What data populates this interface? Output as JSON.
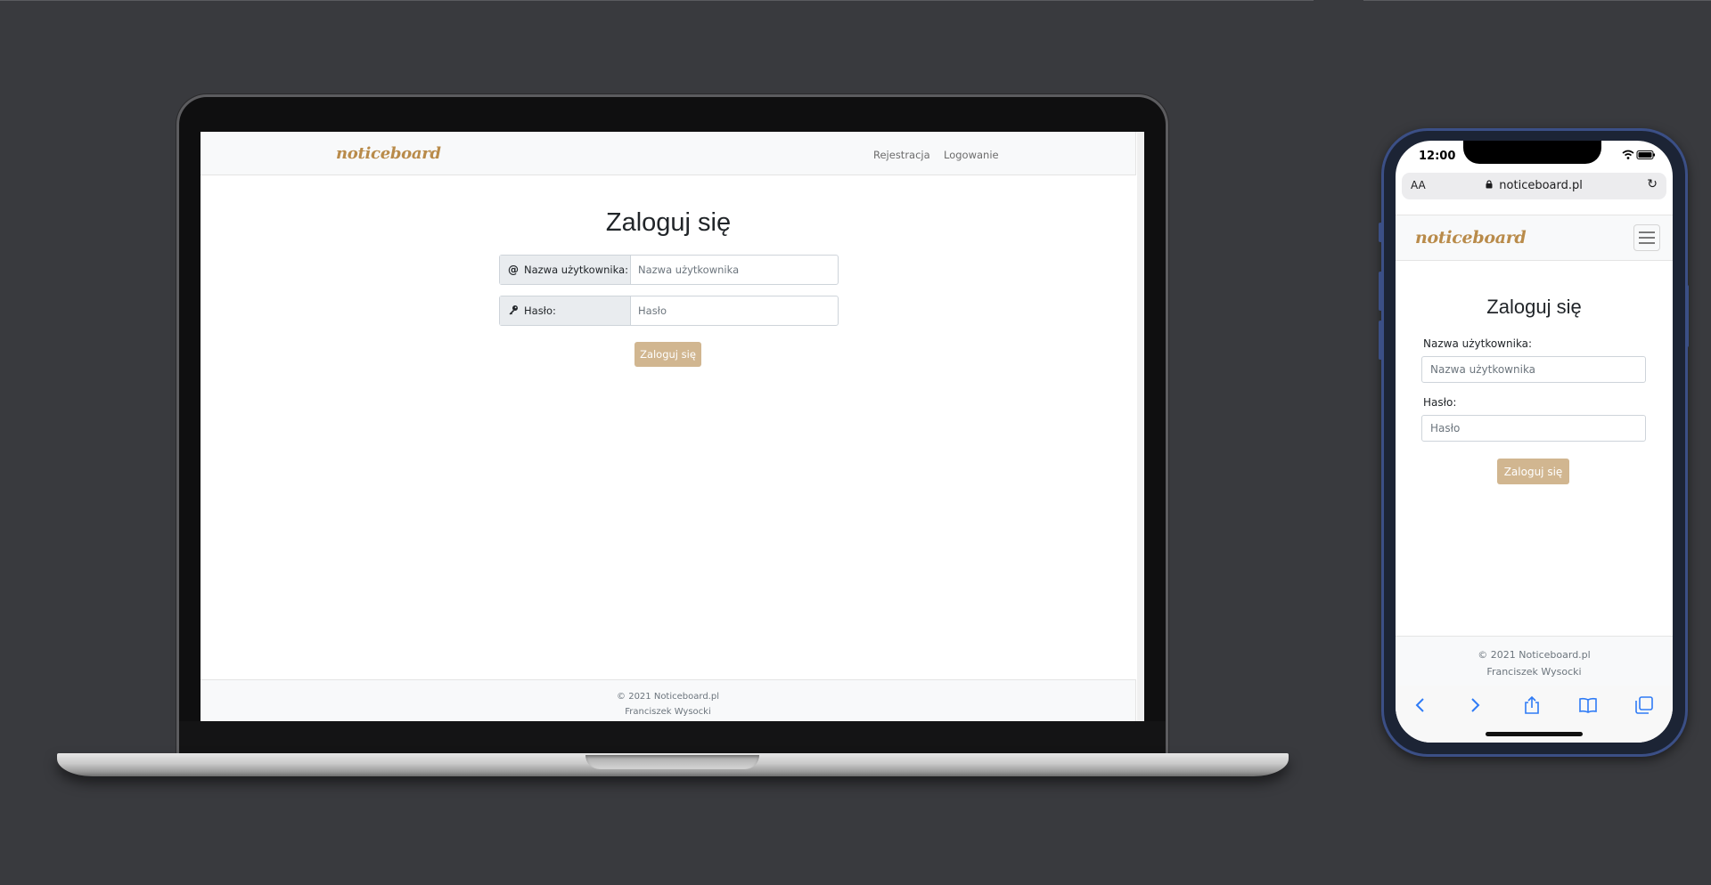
{
  "laptop": {
    "brand": "noticeboard",
    "nav_links": [
      "Rejestracja",
      "Logowanie"
    ],
    "title": "Zaloguj się",
    "username_label": "Nazwa użytkownika:",
    "username_placeholder": "Nazwa użytkownika",
    "password_label": "Hasło:",
    "password_placeholder": "Hasło",
    "submit_label": "Zaloguj się",
    "footer_line1": "© 2021 Noticeboard.pl",
    "footer_line2": "Franciszek Wysocki"
  },
  "phone": {
    "status_time": "12:00",
    "url_aa": "AA",
    "url": "noticeboard.pl",
    "brand": "noticeboard",
    "title": "Zaloguj się",
    "username_label": "Nazwa użytkownika:",
    "username_placeholder": "Nazwa użytkownika",
    "password_label": "Hasło:",
    "password_placeholder": "Hasło",
    "submit_label": "Zaloguj się",
    "footer_line1": "© 2021 Noticeboard.pl",
    "footer_line2": "Franciszek Wysocki"
  },
  "colors": {
    "background": "#393a3e",
    "brand": "#b98b4a",
    "button": "#d1b690",
    "navbar": "#f8f9fa",
    "safari_blue": "#2f7bf6"
  },
  "icons": {
    "username_addon": "at-icon",
    "password_addon": "key-icon",
    "toolbar": [
      "back-icon",
      "forward-icon",
      "share-icon",
      "bookmarks-icon",
      "tabs-icon"
    ]
  }
}
